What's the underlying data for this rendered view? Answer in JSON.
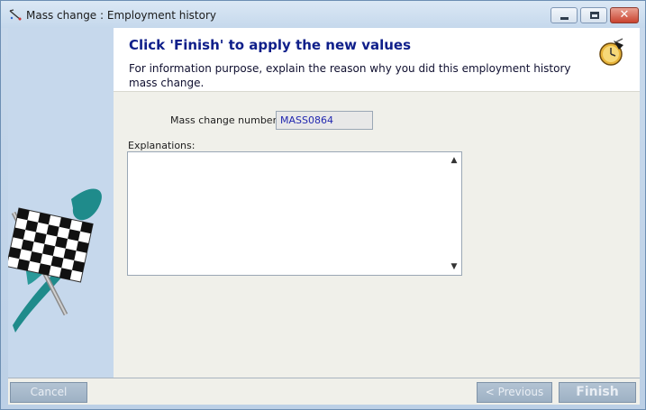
{
  "window": {
    "title": "Mass change : Employment history"
  },
  "header": {
    "title": "Click 'Finish' to apply the new values",
    "description": "For information purpose, explain the reason why you did this employment history mass change."
  },
  "form": {
    "mass_change_number_label": "Mass change number",
    "mass_change_number_value": "MASS0864",
    "explanations_label": "Explanations:",
    "explanations_value": ""
  },
  "footer": {
    "cancel_label": "Cancel",
    "previous_label": "< Previous",
    "finish_label": "Finish"
  }
}
